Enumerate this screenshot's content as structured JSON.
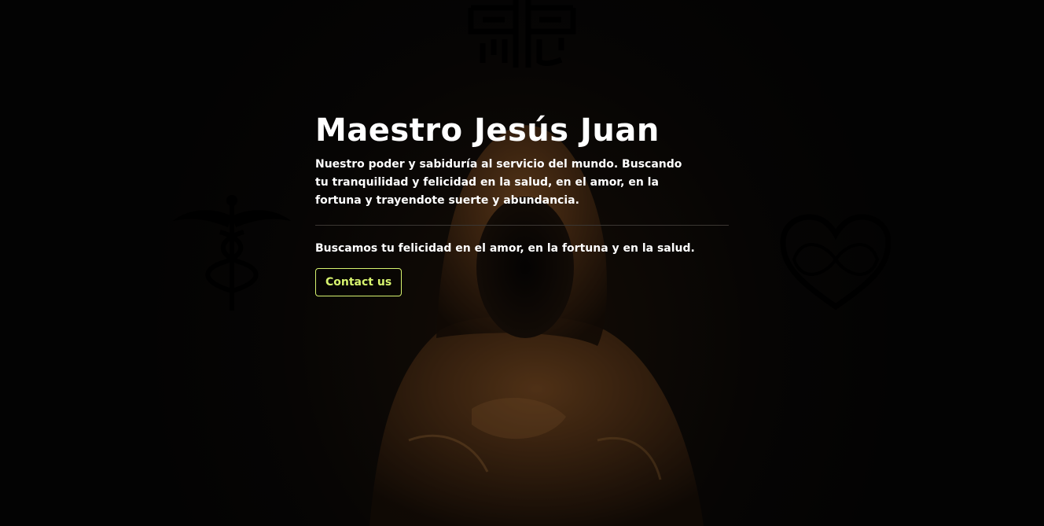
{
  "hero": {
    "title": "Maestro Jesús Juan",
    "lead": "Nuestro poder y sabiduría al servicio del mundo. Buscando tu tranquilidad y felicidad en la salud, en el amor, en la fortuna y trayendote suerte y abundancia.",
    "subline": "Buscamos tu felicidad en el amor, en la fortuna y en la salud.",
    "cta_label": "Contact us"
  },
  "background": {
    "image": "hooded-figure",
    "icons": [
      "chinese-seal-icon",
      "caduceus-icon",
      "heart-infinity-icon"
    ]
  },
  "colors": {
    "accent": "#d7f36f",
    "text": "#ffffff",
    "background": "#050505",
    "robe": "#7a4a22"
  }
}
